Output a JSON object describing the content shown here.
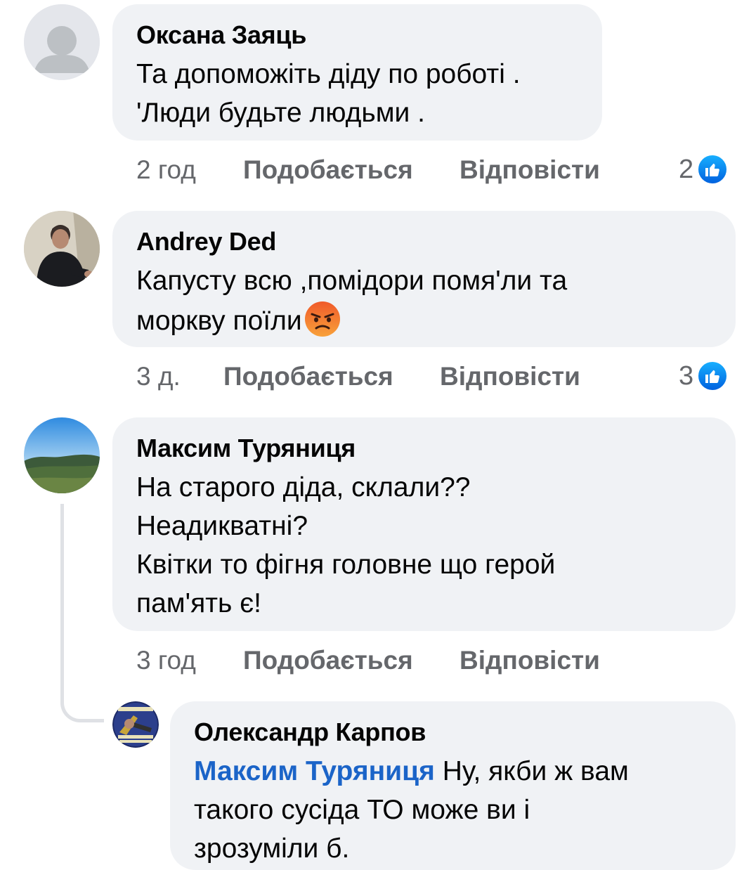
{
  "comments": [
    {
      "author": "Оксана Заяць",
      "text": "Та допоможіть діду по роботі .\n'Люди будьте людьми .",
      "time": "2 год",
      "like_label": "Подобається",
      "reply_label": "Відповісти",
      "likes": "2",
      "avatar_icon": "default-person-icon"
    },
    {
      "author": "Andrey Ded",
      "text": "Капусту всю ,помідори помя'ли та\nморкву поїли",
      "emoji": "angry-face-emoji",
      "time": "3 д.",
      "like_label": "Подобається",
      "reply_label": "Відповісти",
      "likes": "3",
      "avatar_icon": "person-photo"
    },
    {
      "author": "Максим Туряниця",
      "text": "На старого діда, склали??\nНеадикватні?\nКвітки то фігня головне що герой\nпам'ять є!",
      "time": "3 год",
      "like_label": "Подобається",
      "reply_label": "Відповісти",
      "avatar_icon": "landscape-photo"
    }
  ],
  "reply": {
    "author": "Олександр Карпов",
    "mention": "Максим Туряниця",
    "text": " Ну, якби ж вам\nтакого сусіда ТО може ви і\nзрозуміли б.",
    "avatar_icon": "badge-photo"
  },
  "colors": {
    "bubble": "#f0f2f5",
    "meta": "#65676b",
    "mention": "#1b64c8",
    "like": "#0866ff"
  }
}
